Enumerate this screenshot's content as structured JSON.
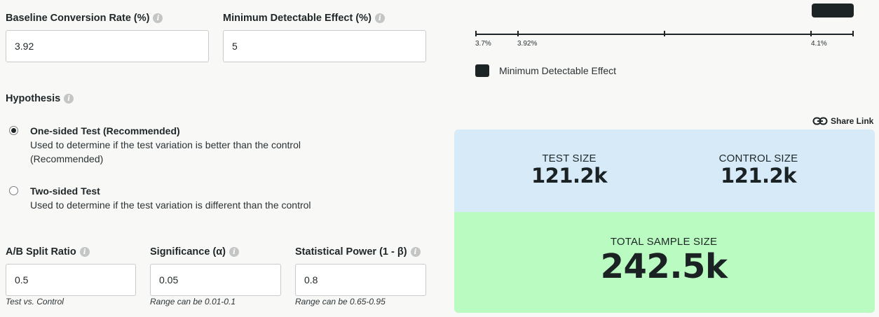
{
  "baseline": {
    "label": "Baseline Conversion Rate (%)",
    "value": "3.92",
    "info_icon": "info-icon"
  },
  "mde": {
    "label": "Minimum Detectable Effect (%)",
    "value": "5",
    "info_icon": "info-icon"
  },
  "hypothesis": {
    "label": "Hypothesis",
    "options": [
      {
        "title": "One-sided Test (Recommended)",
        "desc_line1": "Used to determine if the test variation is better than the control",
        "desc_line2": "(Recommended)",
        "selected": true
      },
      {
        "title": "Two-sided Test",
        "desc_line1": "Used to determine if the test variation is different than the control",
        "selected": false
      }
    ]
  },
  "split": {
    "label": "A/B Split Ratio",
    "value": "0.5",
    "hint": "Test vs. Control"
  },
  "significance": {
    "label": "Significance (α)",
    "value": "0.05",
    "hint": "Range can be 0.01-0.1"
  },
  "power": {
    "label": "Statistical Power (1 - β)",
    "value": "0.8",
    "hint": "Range can be 0.65-0.95"
  },
  "range_chart": {
    "ticks": [
      "3.7%",
      "3.92%",
      "4.1%"
    ],
    "legend": "Minimum Detectable Effect",
    "color": "#1d2426"
  },
  "share": {
    "label": "Share Link",
    "icon": "link-icon"
  },
  "results": {
    "test_size_label": "TEST SIZE",
    "test_size_value": "121.2k",
    "control_size_label": "CONTROL SIZE",
    "control_size_value": "121.2k",
    "total_label": "TOTAL SAMPLE SIZE",
    "total_value": "242.5k",
    "top_color": "#d6eaf8",
    "bottom_color": "#b9fbc0"
  }
}
